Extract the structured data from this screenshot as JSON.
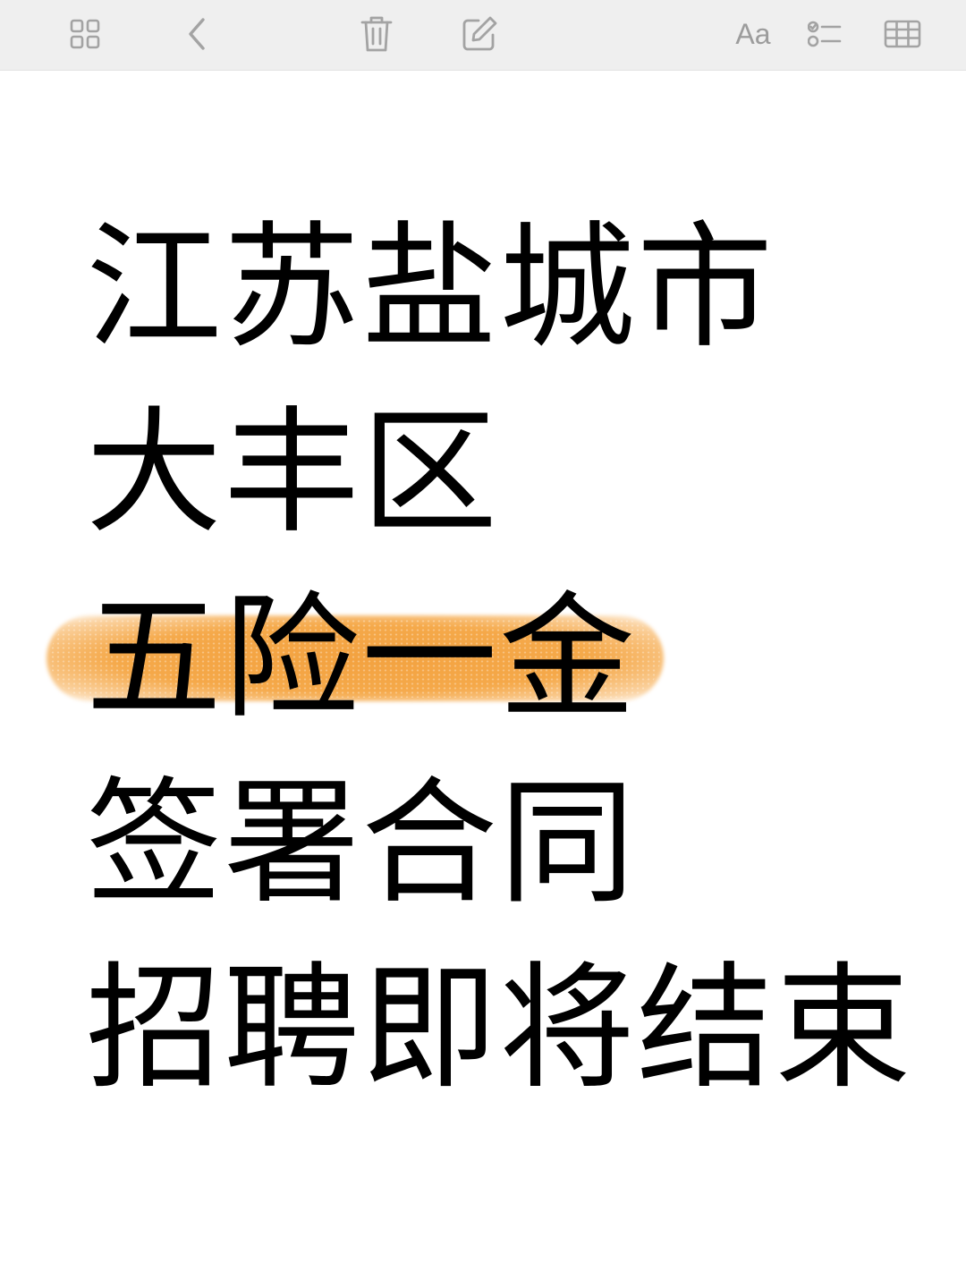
{
  "toolbar": {
    "buttons": [
      {
        "name": "gallery-view",
        "icon": "grid-icon"
      },
      {
        "name": "back",
        "icon": "chevron-left-icon"
      },
      {
        "name": "delete",
        "icon": "trash-icon"
      },
      {
        "name": "compose",
        "icon": "compose-icon"
      },
      {
        "name": "format",
        "icon": "text-format-icon",
        "label": "Aa"
      },
      {
        "name": "checklist",
        "icon": "checklist-icon"
      },
      {
        "name": "table",
        "icon": "table-icon"
      }
    ],
    "icon_color": "#a3a3a3",
    "background": "#efefef"
  },
  "note": {
    "lines": [
      "江苏盐城市",
      "大丰区",
      "五险一金",
      "签署合同",
      "招聘即将结束"
    ],
    "highlighted_line_index": 2,
    "highlight_color": "#f3a240"
  }
}
